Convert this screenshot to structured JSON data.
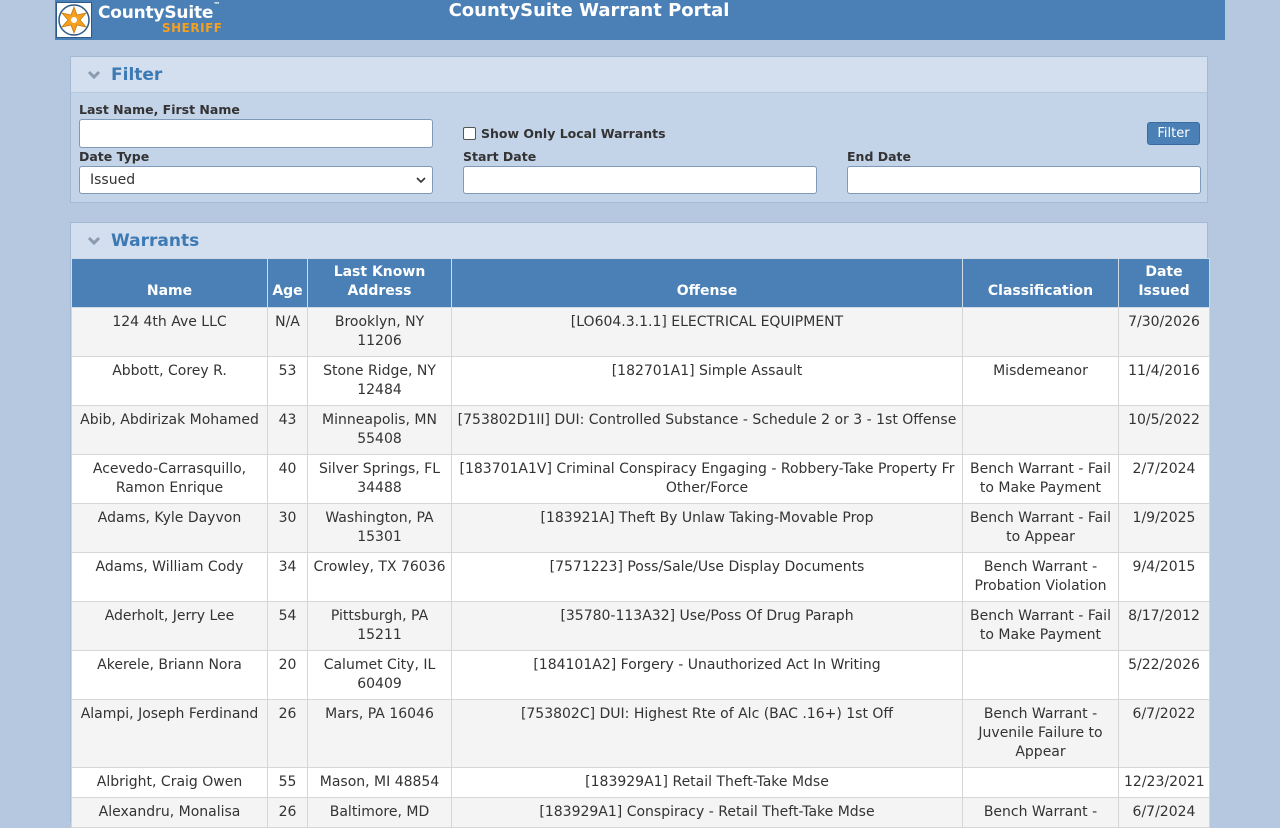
{
  "header": {
    "logo_name": "CountySuite",
    "logo_tm": "™",
    "logo_sub": "SHERIFF",
    "title": "CountySuite Warrant Portal"
  },
  "filter": {
    "title": "Filter",
    "name_label": "Last Name, First Name",
    "name_value": "",
    "local_label": "Show Only Local Warrants",
    "local_checked": false,
    "filter_button": "Filter",
    "date_type_label": "Date Type",
    "date_type_value": "Issued",
    "start_label": "Start Date",
    "start_value": "",
    "end_label": "End Date",
    "end_value": ""
  },
  "warrants": {
    "title": "Warrants",
    "columns": [
      "Name",
      "Age",
      "Last Known Address",
      "Offense",
      "Classification",
      "Date Issued"
    ],
    "rows": [
      {
        "name": "124 4th Ave LLC",
        "age": "N/A",
        "address": "Brooklyn, NY 11206",
        "offense": "[LO604.3.1.1] ELECTRICAL EQUIPMENT",
        "classification": "",
        "date": "7/30/2026"
      },
      {
        "name": "Abbott, Corey R.",
        "age": "53",
        "address": "Stone Ridge, NY 12484",
        "offense": "[182701A1] Simple Assault",
        "classification": "Misdemeanor",
        "date": "11/4/2016"
      },
      {
        "name": "Abib, Abdirizak Mohamed",
        "age": "43",
        "address": "Minneapolis, MN 55408",
        "offense": "[753802D1II] DUI: Controlled Substance - Schedule 2 or 3 - 1st Offense",
        "classification": "",
        "date": "10/5/2022"
      },
      {
        "name": "Acevedo-Carrasquillo, Ramon Enrique",
        "age": "40",
        "address": "Silver Springs, FL 34488",
        "offense": "[183701A1V] Criminal Conspiracy Engaging - Robbery-Take Property Fr Other/Force",
        "classification": "Bench Warrant - Fail to Make Payment",
        "date": "2/7/2024"
      },
      {
        "name": "Adams, Kyle Dayvon",
        "age": "30",
        "address": "Washington, PA 15301",
        "offense": "[183921A] Theft By Unlaw Taking-Movable Prop",
        "classification": "Bench Warrant - Fail to Appear",
        "date": "1/9/2025"
      },
      {
        "name": "Adams, William Cody",
        "age": "34",
        "address": "Crowley, TX 76036",
        "offense": "[7571223] Poss/Sale/Use Display Documents",
        "classification": "Bench Warrant - Probation Violation",
        "date": "9/4/2015"
      },
      {
        "name": "Aderholt, Jerry Lee",
        "age": "54",
        "address": "Pittsburgh, PA 15211",
        "offense": "[35780-113A32] Use/Poss Of Drug Paraph",
        "classification": "Bench Warrant - Fail to Make Payment",
        "date": "8/17/2012"
      },
      {
        "name": "Akerele, Briann Nora",
        "age": "20",
        "address": "Calumet City, IL 60409",
        "offense": "[184101A2] Forgery - Unauthorized Act In Writing",
        "classification": "",
        "date": "5/22/2026"
      },
      {
        "name": "Alampi, Joseph Ferdinand",
        "age": "26",
        "address": "Mars, PA 16046",
        "offense": "[753802C] DUI: Highest Rte of Alc (BAC .16+) 1st Off",
        "classification": "Bench Warrant - Juvenile Failure to Appear",
        "date": "6/7/2022"
      },
      {
        "name": "Albright, Craig Owen",
        "age": "55",
        "address": "Mason, MI 48854",
        "offense": "[183929A1] Retail Theft-Take Mdse",
        "classification": "",
        "date": "12/23/2021"
      },
      {
        "name": "Alexandru, Monalisa",
        "age": "26",
        "address": "Baltimore, MD",
        "offense": "[183929A1] Conspiracy - Retail Theft-Take Mdse",
        "classification": "Bench Warrant -",
        "date": "6/7/2024"
      }
    ]
  },
  "colors": {
    "page_bg": "#b5c8df",
    "topbar": "#4a80b5",
    "accent": "#3d79b3",
    "logo_orange": "#f5a01e"
  }
}
